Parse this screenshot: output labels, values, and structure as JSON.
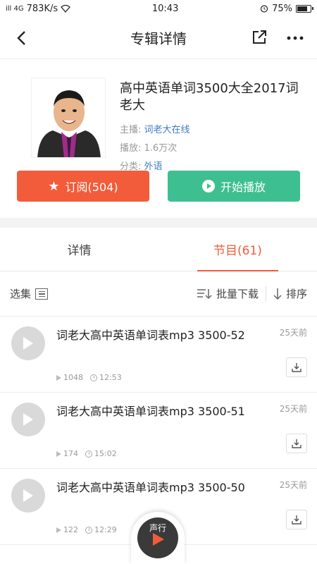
{
  "status": {
    "signal": "ill 4G",
    "speed": "783K/s",
    "time": "10:43",
    "battery": "75%",
    "battery_level": 0.75
  },
  "nav": {
    "title": "专辑详情"
  },
  "album": {
    "title": "高中英语单词3500大全2017词老大",
    "host_label": "主播:",
    "host": "词老大在线",
    "plays_label": "播放:",
    "plays": "1.6万次",
    "category_label": "分类:",
    "category": "外语"
  },
  "actions": {
    "subscribe": "订阅(504)",
    "play": "开始播放"
  },
  "tabs": [
    {
      "label": "详情"
    },
    {
      "label": "节目(61)"
    }
  ],
  "toolbar": {
    "select": "选集",
    "batch": "批量下载",
    "sort": "排序"
  },
  "episodes": [
    {
      "title": "词老大高中英语单词表mp3 3500-52",
      "date": "25天前",
      "plays": "1048",
      "duration": "12:53"
    },
    {
      "title": "词老大高中英语单词表mp3 3500-51",
      "date": "25天前",
      "plays": "174",
      "duration": "15:02"
    },
    {
      "title": "词老大高中英语单词表mp3 3500-50",
      "date": "25天前",
      "plays": "122",
      "duration": "12:29"
    }
  ],
  "player": {
    "text": "声行"
  },
  "colors": {
    "accent": "#f25c3b",
    "play": "#3dbf92",
    "link": "#3e7bc0"
  }
}
